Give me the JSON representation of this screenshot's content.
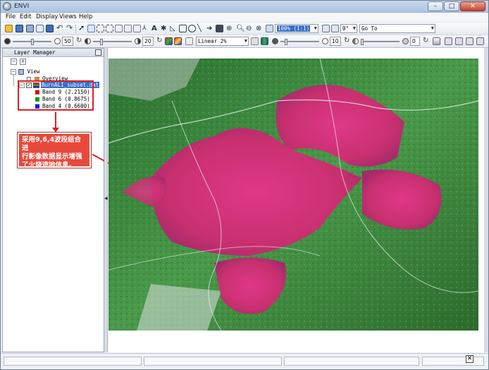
{
  "window": {
    "title": "ENVI",
    "buttons": {
      "minimize": "–",
      "maximize": "□",
      "close": "✕"
    }
  },
  "menu": [
    "File",
    "Edit",
    "Display",
    "Views",
    "Help"
  ],
  "toolbar1": {
    "zoom_value": "100% (1:1)",
    "rotation_value": "0°",
    "goto_placeholder": "Go To"
  },
  "toolbar2": {
    "brightness_value": "50",
    "contrast_value": "20",
    "stretch_value": "Linear 2%",
    "sharpen_value": "10",
    "transparency_value": "0",
    "opacity_value": "0"
  },
  "layer_manager": {
    "title": "Layer Manager",
    "tree": {
      "root": "View",
      "overview": "Overview",
      "layer_name": "BurnALI_subset.dat",
      "bands": [
        {
          "label": "Band 9 (2.2150)",
          "color": "#e00000"
        },
        {
          "label": "Band 6 (0.8675)",
          "color": "#00a000"
        },
        {
          "label": "Band 4 (0.6600)",
          "color": "#0000ff"
        }
      ]
    }
  },
  "annotation": {
    "text": "采用9,6,4波段组合进行影像数据显示增强了火烧迹地信息。",
    "line1": "采用9,6,4波段组合进",
    "line2": "行影像数据显示增强",
    "line3": "了火烧迹地信息。",
    "color": "#e8493b"
  },
  "icons": {
    "band_red_swatch": "#e00000",
    "band_green_swatch": "#00a000",
    "band_blue_swatch": "#0000ff",
    "burn_color": "#d0307a",
    "vegetation_color": "#2f7a33"
  }
}
